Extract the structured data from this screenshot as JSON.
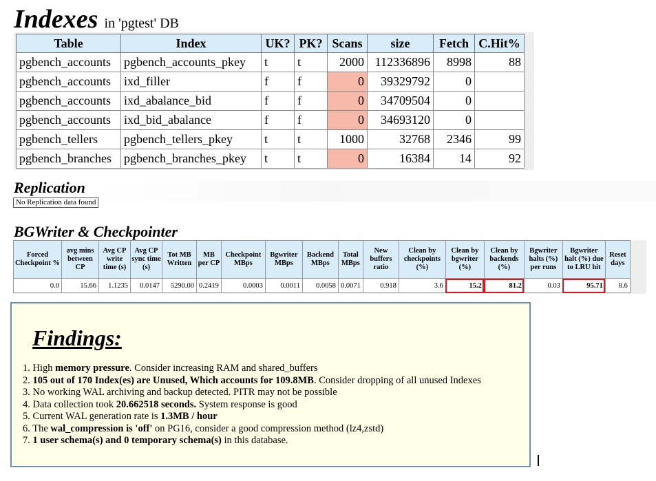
{
  "indexes": {
    "title": "Indexes",
    "subtitle": "in 'pgtest' DB",
    "headers": [
      "Table",
      "Index",
      "UK?",
      "PK?",
      "Scans",
      "size",
      "Fetch",
      "C.Hit%"
    ],
    "rows": [
      {
        "table": "pgbench_accounts",
        "index": "pgbench_accounts_pkey",
        "uk": "t",
        "pk": "t",
        "scans": "2000",
        "size": "112336896",
        "fetch": "8998",
        "chit": "88",
        "zero": false
      },
      {
        "table": "pgbench_accounts",
        "index": "ixd_filler",
        "uk": "f",
        "pk": "f",
        "scans": "0",
        "size": "39329792",
        "fetch": "0",
        "chit": "",
        "zero": true
      },
      {
        "table": "pgbench_accounts",
        "index": "ixd_abalance_bid",
        "uk": "f",
        "pk": "f",
        "scans": "0",
        "size": "34709504",
        "fetch": "0",
        "chit": "",
        "zero": true
      },
      {
        "table": "pgbench_accounts",
        "index": "ixd_bid_abalance",
        "uk": "f",
        "pk": "f",
        "scans": "0",
        "size": "34693120",
        "fetch": "0",
        "chit": "",
        "zero": true
      },
      {
        "table": "pgbench_tellers",
        "index": "pgbench_tellers_pkey",
        "uk": "t",
        "pk": "t",
        "scans": "1000",
        "size": "32768",
        "fetch": "2346",
        "chit": "99",
        "zero": false
      },
      {
        "table": "pgbench_branches",
        "index": "pgbench_branches_pkey",
        "uk": "t",
        "pk": "t",
        "scans": "0",
        "size": "16384",
        "fetch": "14",
        "chit": "92",
        "zero": true
      }
    ]
  },
  "replication": {
    "title": "Replication",
    "message": "No Replication data found"
  },
  "bgwriter": {
    "title": "BGWriter & Checkpointer",
    "headers": [
      "Forced Checkpoint %",
      "avg mins between CP",
      "Avg CP write time (s)",
      "Avg CP sync time (s)",
      "Tot MB Written",
      "MB per CP",
      "Checkpoint MBps",
      "Bgwriter MBps",
      "Backend MBps",
      "Total MBps",
      "New buffers ratio",
      "Clean by checkpoints (%)",
      "Clean by bgwriter (%)",
      "Clean by backends (%)",
      "Bgwriter halts (%) per runs",
      "Bgwriter halt (%) due to LRU hit",
      "Reset days"
    ],
    "values": [
      "0.0",
      "15.66",
      "1.1235",
      "0.0147",
      "5290.00",
      "0.2419",
      "0.0003",
      "0.0011",
      "0.0058",
      "0.0071",
      "0.918",
      "3.6",
      "15.2",
      "81.2",
      "0.03",
      "95.71",
      "8.6"
    ],
    "highlight_color": "#e0161e"
  },
  "findings": {
    "title": "Findings:",
    "items": [
      {
        "num": "1.",
        "parts": [
          {
            "t": "High "
          },
          {
            "b": "memory pressure"
          },
          {
            "t": ". Consider increasing RAM and shared_buffers"
          }
        ]
      },
      {
        "num": "2.",
        "parts": [
          {
            "b": "105 out of 170 Index(es) are Unused, Which accounts for 109.8MB"
          },
          {
            "t": ". Consider dropping of all unused Indexes"
          }
        ]
      },
      {
        "num": "3.",
        "parts": [
          {
            "t": "No working WAL archiving and backup detected. PITR may not be possible"
          }
        ]
      },
      {
        "num": "4.",
        "parts": [
          {
            "t": "Data collection took "
          },
          {
            "b": "20.662518 seconds."
          },
          {
            "t": " System response is good"
          }
        ]
      },
      {
        "num": "5.",
        "parts": [
          {
            "t": "Current WAL generation rate is "
          },
          {
            "b": "1.3MB / hour"
          }
        ]
      },
      {
        "num": "6.",
        "parts": [
          {
            "t": "The "
          },
          {
            "b": "wal_compression is 'off'"
          },
          {
            "t": " on PG16, consider a good compression method (lz4,zstd)"
          }
        ]
      },
      {
        "num": "7.",
        "parts": [
          {
            "b": "1 user schema(s) and 0 temporary schema(s)"
          },
          {
            "t": " in this database."
          }
        ]
      }
    ]
  },
  "colors": {
    "header_bg": "#d8ecf9",
    "zero_scan_bg": "#f6b9a9",
    "findings_bg": "#ffffe8",
    "findings_border": "#6b8cc8"
  }
}
